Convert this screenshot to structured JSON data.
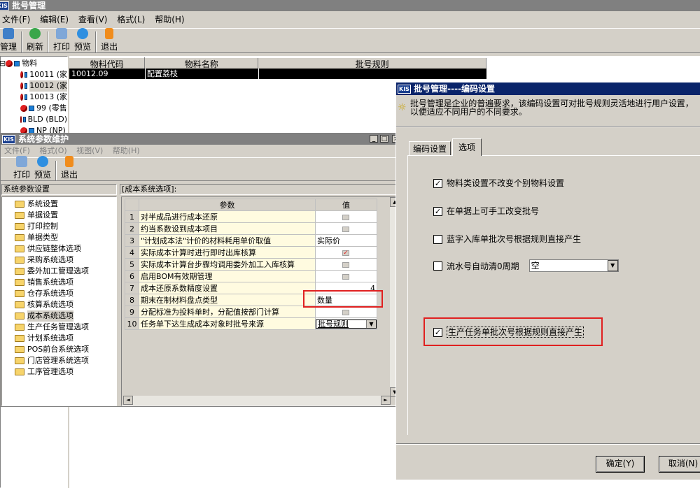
{
  "main": {
    "title": "批号管理",
    "menu": [
      "文件(F)",
      "编辑(E)",
      "查看(V)",
      "格式(L)",
      "帮助(H)"
    ],
    "toolbar": [
      {
        "label": "管理",
        "icon": "manage-icon"
      },
      {
        "label": "刷新",
        "icon": "refresh-icon"
      },
      {
        "label": "打印",
        "icon": "print-icon"
      },
      {
        "label": "预览",
        "icon": "preview-icon"
      },
      {
        "label": "退出",
        "icon": "exit-icon"
      }
    ],
    "tree": {
      "root": "物料",
      "items": [
        "10011 (家",
        "10012 (家",
        "10013 (家",
        "99 (零售",
        "BLD (BLD)",
        "NP (NP)"
      ]
    },
    "grid": {
      "headers": [
        "物料代码",
        "物料名称",
        "批号规则"
      ],
      "row": {
        "code": "10012.09",
        "name": "配置荔枝",
        "rule": ""
      }
    }
  },
  "sysparam": {
    "title": "系统参数维护",
    "menu": [
      "文件(F)",
      "格式(O)",
      "视图(V)",
      "帮助(H)"
    ],
    "toolbar": [
      {
        "label": "打印",
        "icon": "print-icon"
      },
      {
        "label": "预览",
        "icon": "preview-icon"
      },
      {
        "label": "退出",
        "icon": "exit-icon"
      }
    ],
    "left_title": "系统参数设置",
    "tree": [
      "系统设置",
      "单据设置",
      "打印控制",
      "单据类型",
      "供应链整体选项",
      "采购系统选项",
      "委外加工管理选项",
      "销售系统选项",
      "仓存系统选项",
      "核算系统选项",
      "成本系统选项",
      "生产任务管理选项",
      "计划系统选项",
      "POS前台系统选项",
      "门店管理系统选项",
      "工序管理选项"
    ],
    "right_title": "[成本系统选项]:",
    "table_headers": [
      "参数",
      "值"
    ],
    "rows": [
      {
        "n": "1",
        "name": "对半成品进行成本还原",
        "val": "",
        "type": "check"
      },
      {
        "n": "2",
        "name": "约当系数设到成本项目",
        "val": "",
        "type": "check"
      },
      {
        "n": "3",
        "name": "\"计划成本法\"计价的材料耗用单价取值",
        "val": "实际价",
        "type": "text"
      },
      {
        "n": "4",
        "name": "实际成本计算时进行即时出库核算",
        "val": "",
        "type": "checked"
      },
      {
        "n": "5",
        "name": "实际成本计算台步骤均调用委外加工入库核算",
        "val": "",
        "type": "check"
      },
      {
        "n": "6",
        "name": "启用BOM有效期管理",
        "val": "",
        "type": "check"
      },
      {
        "n": "7",
        "name": "成本还原系数精度设置",
        "val": "4",
        "type": "num"
      },
      {
        "n": "8",
        "name": "期末在制材料盘点类型",
        "val": "数量",
        "type": "text"
      },
      {
        "n": "9",
        "name": "分配标准为投料单时，分配值按部门计算",
        "val": "",
        "type": "check"
      },
      {
        "n": "10",
        "name": "任务单下达生成成本对象时批号来源",
        "val": "批号规则",
        "type": "combo"
      }
    ]
  },
  "coding": {
    "title": "批号管理----编码设置",
    "info": "批号管理是企业的普遍要求，该编码设置可对批号规则灵活地进行用户设置，以便适应不同用户的不同要求。",
    "tabs": [
      "编码设置",
      "选项"
    ],
    "options": [
      {
        "label": "物料类设置不改变个别物料设置",
        "checked": true
      },
      {
        "label": "在单据上可手工改变批号",
        "checked": true
      },
      {
        "label": "蓝字入库单批次号根据规则直接产生",
        "checked": false
      },
      {
        "label": "流水号自动清0周期",
        "checked": false
      },
      {
        "label": "生产任务单批次号根据规则直接产生",
        "checked": true
      }
    ],
    "period_value": "空",
    "ok_label": "确定(Y)",
    "cancel_label": "取消(N)"
  }
}
